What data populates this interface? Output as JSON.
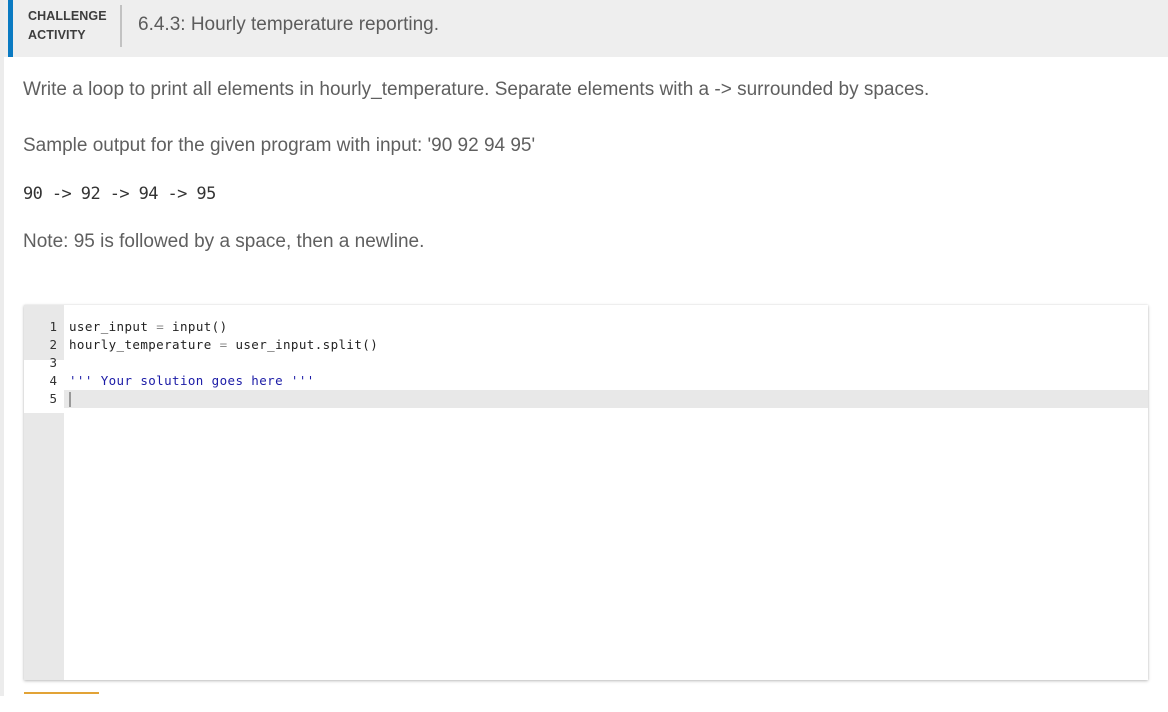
{
  "header": {
    "kind_line1": "CHALLENGE",
    "kind_line2": "ACTIVITY",
    "title": "6.4.3: Hourly temperature reporting."
  },
  "instructions": {
    "prompt": "Write a loop to print all elements in hourly_temperature. Separate elements with a -> surrounded by spaces.",
    "sample_label": "Sample output for the given program with input: '90 92 94 95'",
    "sample_output": "90 -> 92 -> 94 -> 95",
    "note": "Note: 95 is followed by a space, then a newline."
  },
  "editor": {
    "lines": [
      {
        "num": "1",
        "tokens": [
          {
            "t": "user_input ",
            "c": ""
          },
          {
            "t": "=",
            "c": "op"
          },
          {
            "t": " input()",
            "c": ""
          }
        ]
      },
      {
        "num": "2",
        "tokens": [
          {
            "t": "hourly_temperature ",
            "c": ""
          },
          {
            "t": "=",
            "c": "op"
          },
          {
            "t": " user_input.split()",
            "c": ""
          }
        ]
      },
      {
        "num": "3",
        "tokens": []
      },
      {
        "num": "4",
        "tokens": [
          {
            "t": "''' Your solution goes here '''",
            "c": "str"
          }
        ]
      },
      {
        "num": "5",
        "tokens": []
      }
    ]
  },
  "colors": {
    "accent": "#0a7ac2",
    "string": "#1a1aa6",
    "check_button": "#e2a336"
  }
}
